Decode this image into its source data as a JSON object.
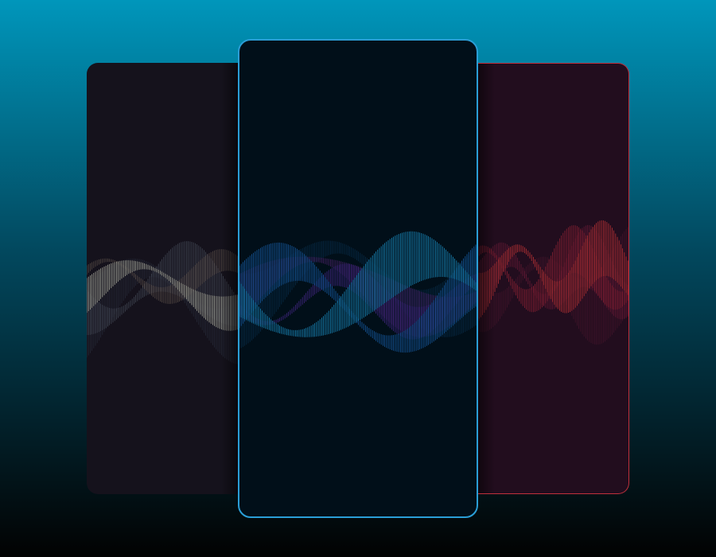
{
  "background": {
    "top_color": "#0096bb",
    "bottom_color": "#020202"
  },
  "cards": {
    "left": {
      "bg": "#15121c",
      "border": "none",
      "wave_colors": [
        "#c9cbb8",
        "#5f6a7a",
        "#8c7a6a",
        "#3a4658"
      ],
      "variant": "left"
    },
    "center": {
      "bg": "#010f19",
      "border": "#2a9ed6",
      "wave_colors": [
        "#1fa3e0",
        "#1c6fc8",
        "#5a2fa8",
        "#6b2a8c",
        "#0b3d66"
      ],
      "variant": "center"
    },
    "right": {
      "bg": "#220d1e",
      "border": "#c0303c",
      "wave_colors": [
        "#d83a3a",
        "#b0283a",
        "#8a2040",
        "#5c1a35"
      ],
      "variant": "right"
    }
  }
}
